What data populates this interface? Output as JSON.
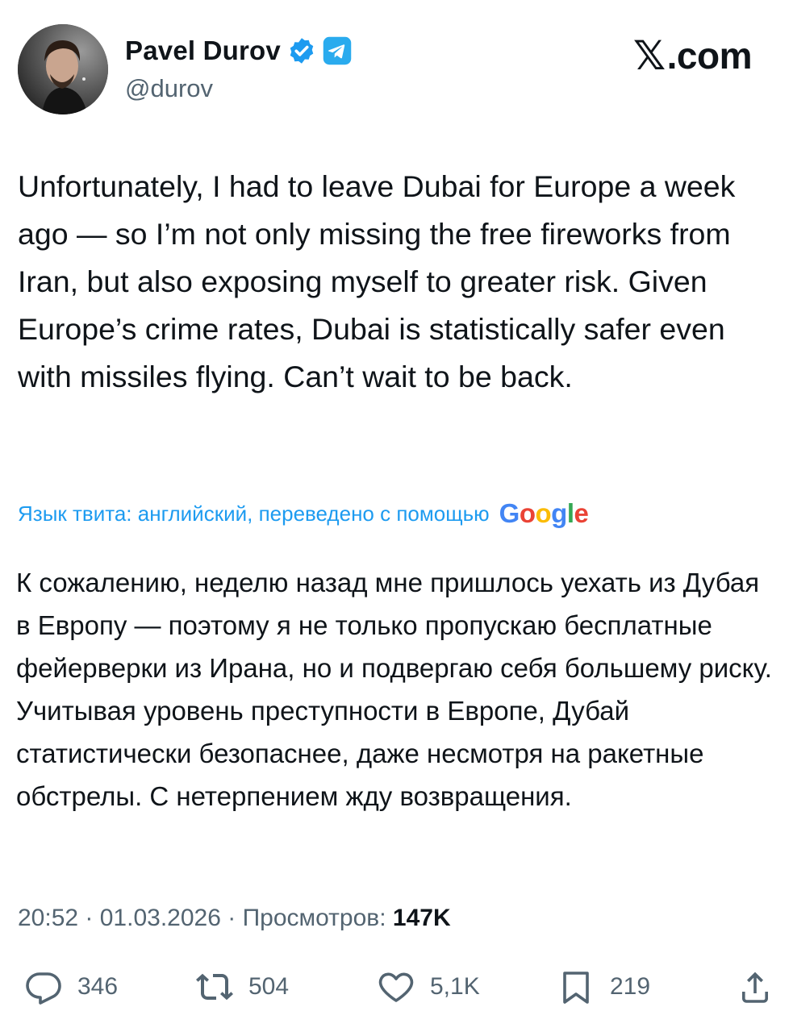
{
  "author": {
    "display_name": "Pavel Durov",
    "handle": "@durov",
    "verified_icon": "verified-badge-icon",
    "telegram_icon": "telegram-icon"
  },
  "site": {
    "logo_mark": "𝕏",
    "logo_text": ".com"
  },
  "tweet": {
    "text": "Unfortunately, I had to leave Dubai for Europe a week ago — so I’m not only missing the free fireworks from Iran, but also exposing myself to greater risk. Given Europe’s crime rates, Dubai is statistically safer even with missiles flying. Can’t wait to be back."
  },
  "translation": {
    "label": "Язык твита: английский, переведено с помощью",
    "provider": {
      "letters": [
        "G",
        "o",
        "o",
        "g",
        "l",
        "e"
      ]
    },
    "text": "К сожалению, неделю назад мне пришлось уехать из Дубая в Европу — поэтому я не только пропускаю бесплатные фейерверки из Ирана, но и подвергаю себя большему риску. Учитывая уровень преступности в Европе, Дубай статистически безопаснее, даже несмотря на ракетные обстрелы. С нетерпением жду возвращения."
  },
  "meta": {
    "time": "20:52",
    "sep1": " · ",
    "date": "01.03.2026",
    "sep2": " · ",
    "views_label": "Просмотров: ",
    "views_count": "147K"
  },
  "actions": {
    "replies": {
      "icon": "reply-icon",
      "count": "346"
    },
    "reposts": {
      "icon": "repost-icon",
      "count": "504"
    },
    "likes": {
      "icon": "like-icon",
      "count": "5,1K"
    },
    "bookmarks": {
      "icon": "bookmark-icon",
      "count": "219"
    },
    "share": {
      "icon": "share-icon"
    }
  },
  "colors": {
    "accent": "#1d9bf0",
    "text": "#0f1419",
    "secondary": "#536471",
    "telegram": "#2aabee"
  }
}
